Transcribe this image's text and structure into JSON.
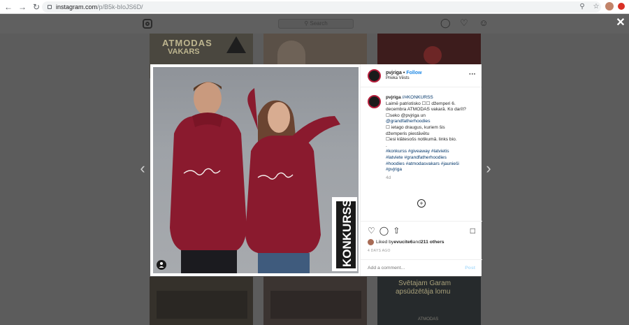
{
  "browser": {
    "url_host": "instagram.com",
    "url_path": "/p/B5k-bIoJS6D/",
    "colors": {
      "brand_red": "#d93025"
    }
  },
  "topbar": {
    "search_placeholder": "Search"
  },
  "tiles_text": {
    "atmodas": "ATMODAS",
    "vakars": "VAKARS",
    "svetajam": "Svētajam Garam",
    "apsudz": "apsūdzētāja lomu",
    "atmodas_small": "ATMODAS"
  },
  "modal": {
    "konkurss": "KONKURSS",
    "header": {
      "username": "pvjriga",
      "separator": "•",
      "follow": "Follow",
      "location": "Prieka Vēsts"
    },
    "caption": {
      "username": "pvjriga",
      "lines": [
        " //#KONKURSS",
        "Laimē patriotisko ☐☐ džemperi 6.",
        "decembra ATMODAS vakarā. Ko darīt?",
        "☐seko @pvjriga un",
        "@grandfatherhoodies",
        "☐ ietago draugus, kuriem šis",
        "džemperis piestāvētu",
        "☐esi klātesošs notikumā. links bio.",
        ".",
        "."
      ],
      "hashtags": [
        "#konkurss #giveaway #latvietis",
        "#latviete #grandfatherhoodies",
        "#hoodies #atmodasvakars #jaunieši",
        "#pvjriga"
      ],
      "age": "4d"
    },
    "likes": {
      "prefix": "Liked by ",
      "user": "evucite6",
      "middle": " and ",
      "count": "211 others"
    },
    "timestamp": "4 DAYS AGO",
    "comment_placeholder": "Add a comment...",
    "post_label": "Post"
  }
}
